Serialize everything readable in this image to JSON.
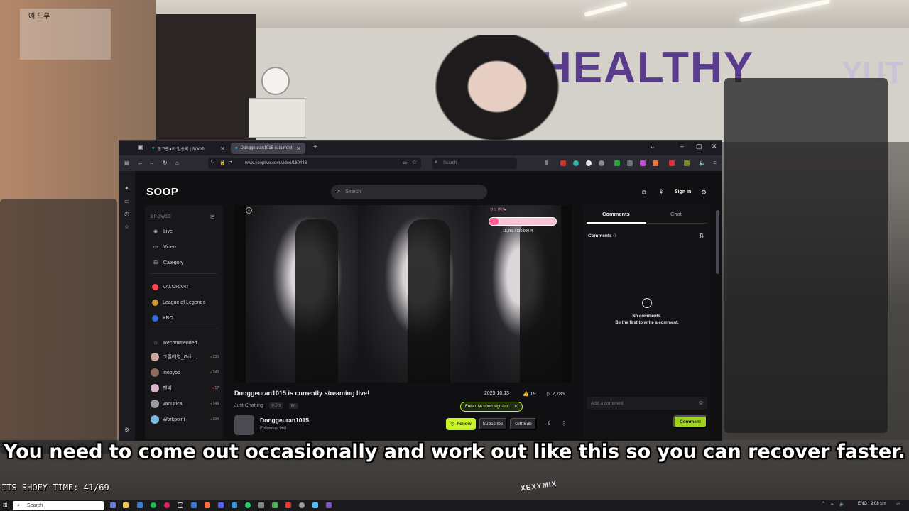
{
  "overlay": {
    "pip_text": "예 드루",
    "subtitle": "You need to come out occasionally and work out like this so you can recover faster.",
    "counter": "ITS SHOEY TIME: 41/69",
    "wall_sign": "HEALTHY",
    "wall_sign_far": "YUT",
    "shirt_brand": "XEXYMIX"
  },
  "browser": {
    "tabs": [
      {
        "label": "동그란●의 방송국 | SOOP",
        "active": false
      },
      {
        "label": "Donggeuran1015 is current",
        "active": true
      }
    ],
    "new_tab": "+",
    "url": "www.sooplive.com/video/169443",
    "search_placeholder": "Search",
    "window_controls": {
      "min": "–",
      "max": "▢",
      "close": "✕"
    }
  },
  "site": {
    "logo": "SOOP",
    "search_placeholder": "Search",
    "sign_in": "Sign in"
  },
  "sidebar": {
    "browse_label": "BROWSE",
    "nav": [
      {
        "label": "Live",
        "icon": "live-icon"
      },
      {
        "label": "Video",
        "icon": "video-icon"
      },
      {
        "label": "Category",
        "icon": "category-icon"
      }
    ],
    "games": [
      {
        "label": "VALORANT",
        "color": "#ff4655"
      },
      {
        "label": "League of Legends",
        "color": "#c89b3c"
      },
      {
        "label": "KBO",
        "color": "#2d6cdf"
      }
    ],
    "recommended_label": "Recommended",
    "recommended": [
      {
        "name": "그릴레영_Grilr...",
        "count": "230",
        "avatar": "#c7a7a0"
      },
      {
        "name": "mooyoo",
        "count": "243",
        "avatar": "#8a6a5a"
      },
      {
        "name": "팬싸",
        "count": "17",
        "avatar": "#d9b3c9"
      },
      {
        "name": "vanOtica",
        "count": "149",
        "avatar": "#9a9aa5"
      },
      {
        "name": "Workpoint",
        "count": "334",
        "avatar": "#7ab6d9"
      }
    ]
  },
  "video": {
    "goal_title": "한이 멘션♥",
    "goal_progress": "15,789 / 110,000 개",
    "goal_fraction": 0.14,
    "title": "Donggeuran1015 is currently streaming live!",
    "category": "Just Chatting",
    "tags": [
      "한국어",
      "IRL"
    ],
    "date": "2025.10.13",
    "likes": "19",
    "views": "2,785",
    "trial_banner": "Free trial upon sign-up!",
    "channel_name": "Donggeuran1015",
    "followers": "Followers 968",
    "follow_label": "Follow",
    "subscribe_label": "Subscribe",
    "gift_label": "Gift Sub"
  },
  "comments_panel": {
    "tab_comments": "Comments",
    "tab_chat": "Chat",
    "comments_label": "Comments",
    "comments_count": "0",
    "empty_line1": "No comments.",
    "empty_line2": "Be the first to write a comment.",
    "input_placeholder": "Add a comment",
    "submit_label": "Comment"
  },
  "taskbar": {
    "search_placeholder": "Search",
    "lang": "ENG",
    "time": "9:08 pm"
  }
}
